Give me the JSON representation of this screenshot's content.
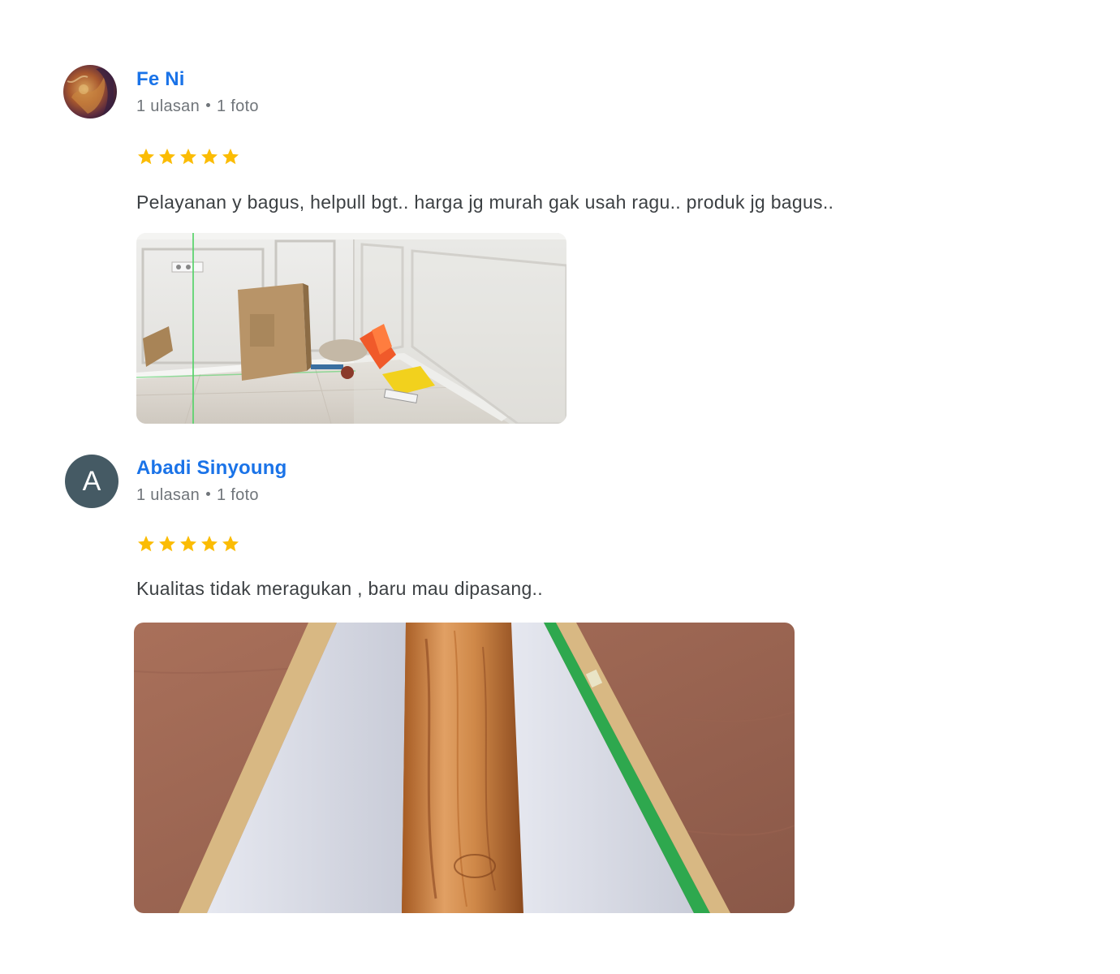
{
  "reviews": [
    {
      "author": "Fe Ni",
      "review_count": "1 ulasan",
      "photo_count": "1 foto",
      "rating": 5,
      "text": "Pelayanan y bagus, helpull bgt.. harga jg murah gak usah ragu.. produk jg bagus..",
      "avatar_type": "photo",
      "photo_desc_icon": "room-photo"
    },
    {
      "author": "Abadi Sinyoung",
      "avatar_letter": "A",
      "review_count": "1 ulasan",
      "photo_count": "1 foto",
      "rating": 5,
      "text": "Kualitas tidak meragukan , baru mau dipasang..",
      "avatar_type": "letter",
      "photo_desc_icon": "wood-roll-photo"
    }
  ],
  "colors": {
    "author_link": "#1a73e8",
    "star": "#fbbc04",
    "meta": "#70757a",
    "text": "#3c4043",
    "avatar_letter_bg": "#455a64"
  }
}
